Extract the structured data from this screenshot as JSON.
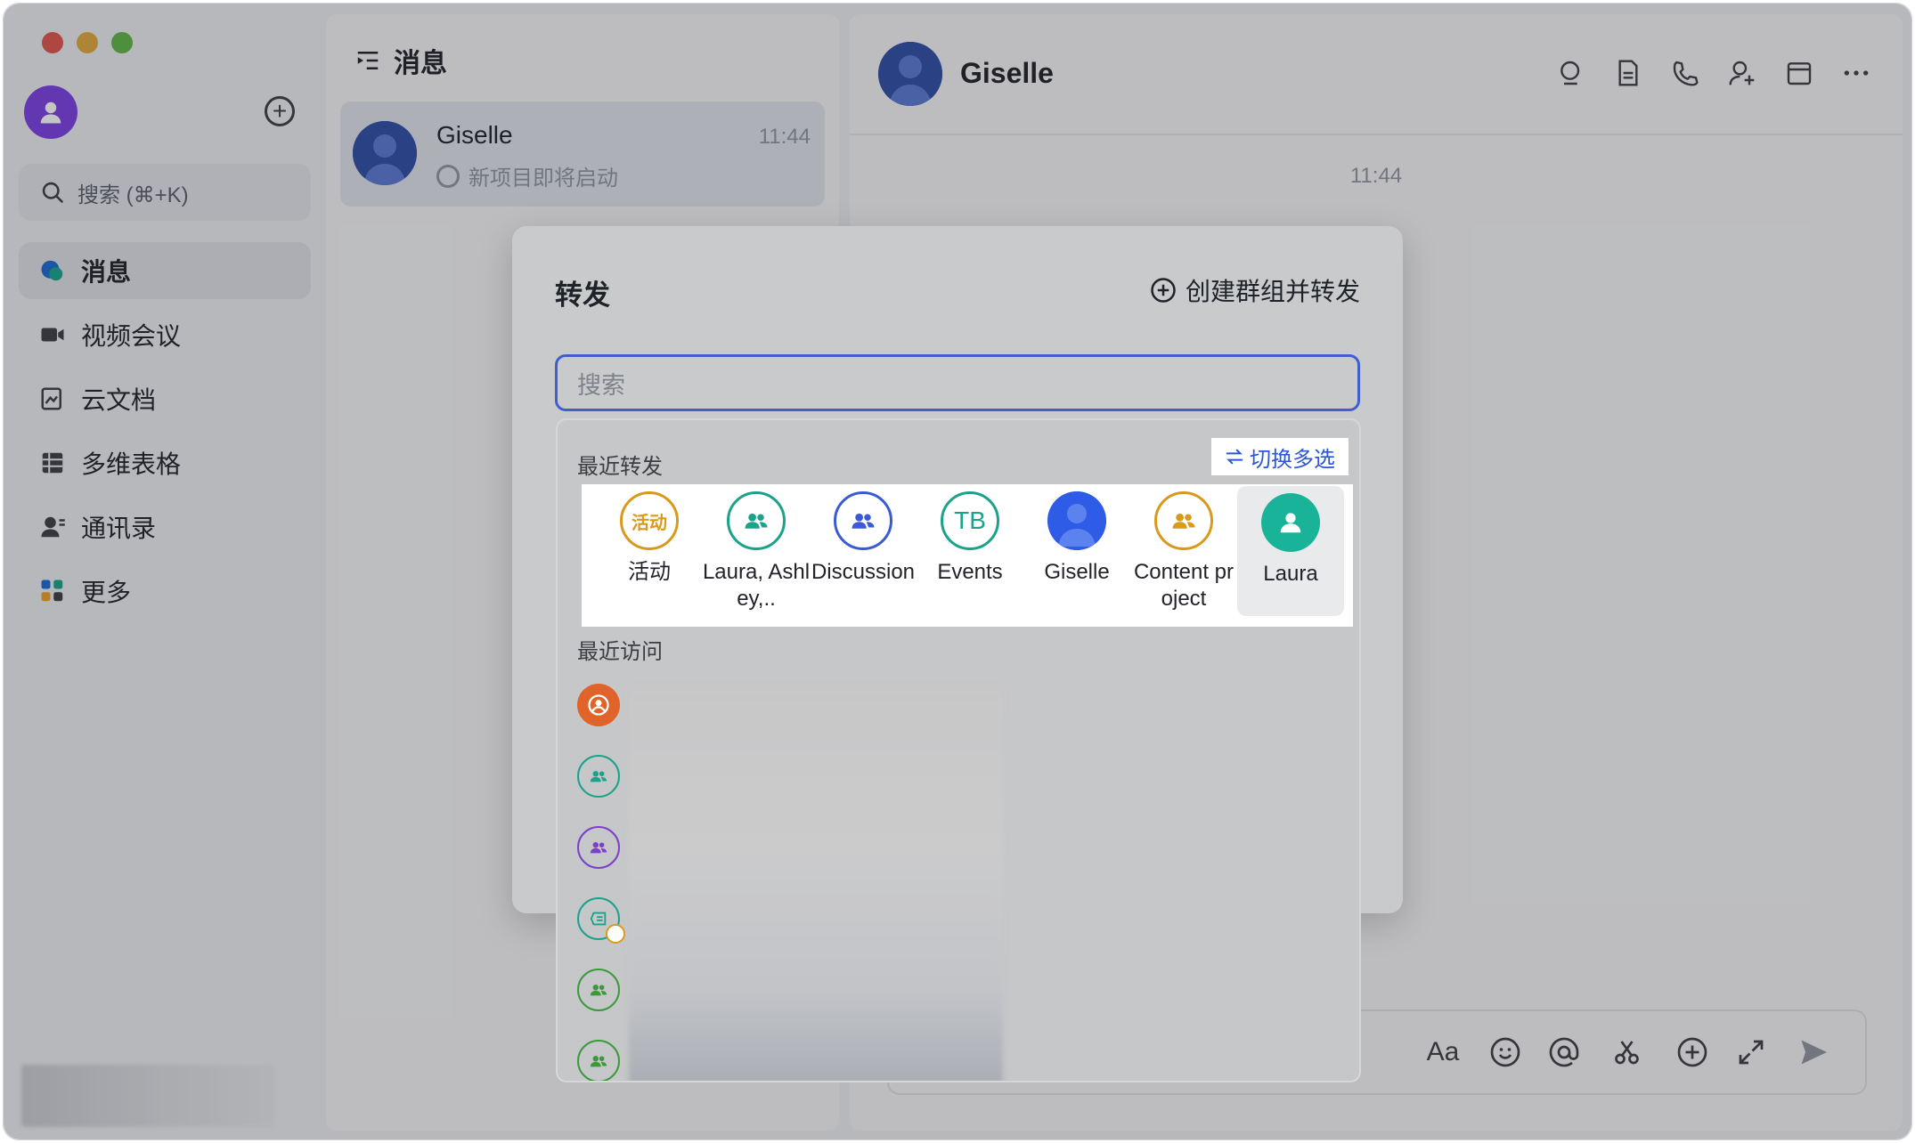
{
  "window": {
    "traffic_colors": [
      "#e0564e",
      "#e1a83d",
      "#5fb548"
    ]
  },
  "sidebar": {
    "search_placeholder": "搜索 (⌘+K)",
    "items": [
      {
        "label": "消息",
        "icon": "message-bubble-icon",
        "active": true
      },
      {
        "label": "视频会议",
        "icon": "video-camera-icon",
        "active": false
      },
      {
        "label": "云文档",
        "icon": "cloud-doc-icon",
        "active": false
      },
      {
        "label": "多维表格",
        "icon": "table-grid-icon",
        "active": false
      },
      {
        "label": "通讯录",
        "icon": "contacts-icon",
        "active": false
      },
      {
        "label": "更多",
        "icon": "more-apps-icon",
        "active": false
      }
    ]
  },
  "conversations": {
    "title": "消息",
    "items": [
      {
        "name": "Giselle",
        "time": "11:44",
        "preview": "新项目即将启动"
      }
    ]
  },
  "chat": {
    "name": "Giselle",
    "time_divider": "11:44",
    "header_tools": [
      "search-icon",
      "doc-icon",
      "phone-icon",
      "add-member-icon",
      "calendar-icon",
      "more-icon"
    ],
    "composer_tools": [
      "text-format-icon",
      "emoji-icon",
      "mention-icon",
      "scissors-icon",
      "plus-circle-icon",
      "expand-icon",
      "send-icon"
    ],
    "composer_text_icon": "Aa"
  },
  "dialog": {
    "title": "转发",
    "create_group_label": "创建群组并转发",
    "search_placeholder": "搜索",
    "recent_title": "最近转发",
    "multi_select_label": "切换多选",
    "visit_title": "最近访问",
    "recent": [
      {
        "label": "活动",
        "avatar_text": "活动",
        "color": "#d99a1c",
        "style": "text"
      },
      {
        "label": "Laura, Ashley,..",
        "avatar_text": "",
        "color": "#1aa38a",
        "style": "group"
      },
      {
        "label": "Discussion",
        "avatar_text": "",
        "color": "#3b5bd6",
        "style": "group"
      },
      {
        "label": "Events",
        "avatar_text": "TB",
        "color": "#1aa38a",
        "style": "text"
      },
      {
        "label": "Giselle",
        "avatar_text": "",
        "color": "#2e5ce6",
        "style": "photo"
      },
      {
        "label": "Content project",
        "avatar_text": "",
        "color": "#d99a1c",
        "style": "group"
      },
      {
        "label": "Laura",
        "avatar_text": "",
        "color": "#19b39a",
        "style": "person"
      }
    ],
    "visits": [
      {
        "color": "#e0632a",
        "style": "filled-location"
      },
      {
        "color": "#1aa38a",
        "style": "group"
      },
      {
        "color": "#7b3fc9",
        "style": "group"
      },
      {
        "color": "#1aa38a",
        "style": "topic"
      },
      {
        "color": "#3a9a3a",
        "style": "group"
      },
      {
        "color": "#3a9a3a",
        "style": "group"
      }
    ]
  }
}
